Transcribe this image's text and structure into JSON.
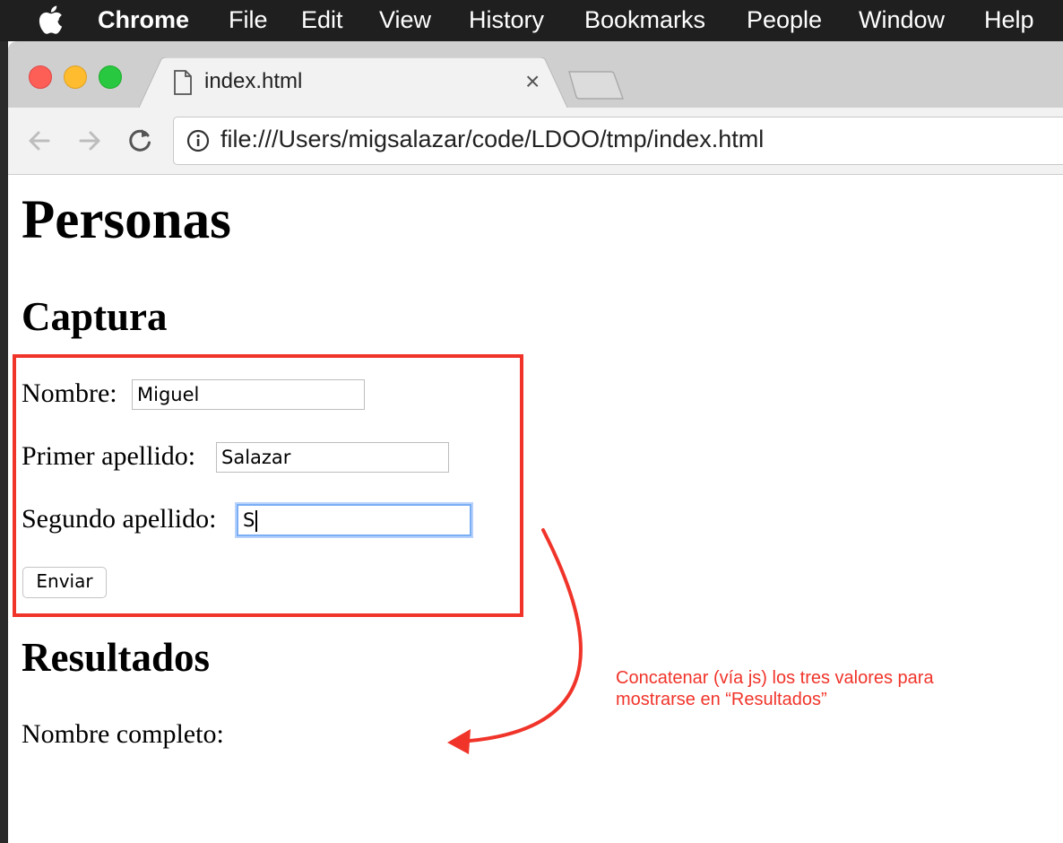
{
  "menubar": {
    "app": "Chrome",
    "items": [
      "File",
      "Edit",
      "View",
      "History",
      "Bookmarks",
      "People",
      "Window",
      "Help"
    ]
  },
  "tab": {
    "title": "index.html",
    "close_glyph": "×"
  },
  "toolbar": {
    "url": "file:///Users/migsalazar/code/LDOO/tmp/index.html"
  },
  "page": {
    "heading": "Personas",
    "capture_heading": "Captura",
    "form": {
      "nombre_label": "Nombre:",
      "nombre_value": "Miguel",
      "primer_label": "Primer apellido:",
      "primer_value": "Salazar",
      "segundo_label": "Segundo apellido:",
      "segundo_value": "S",
      "submit_label": "Enviar"
    },
    "results_heading": "Resultados",
    "full_name_label": "Nombre completo:"
  },
  "annotation": {
    "text": "Concatenar (vía js) los tres valores para mostrarse en “Resultados”",
    "color": "#f0342a"
  },
  "icons": [
    "apple-icon",
    "document-icon",
    "close-icon",
    "back-arrow-icon",
    "forward-arrow-icon",
    "reload-icon",
    "info-icon"
  ]
}
